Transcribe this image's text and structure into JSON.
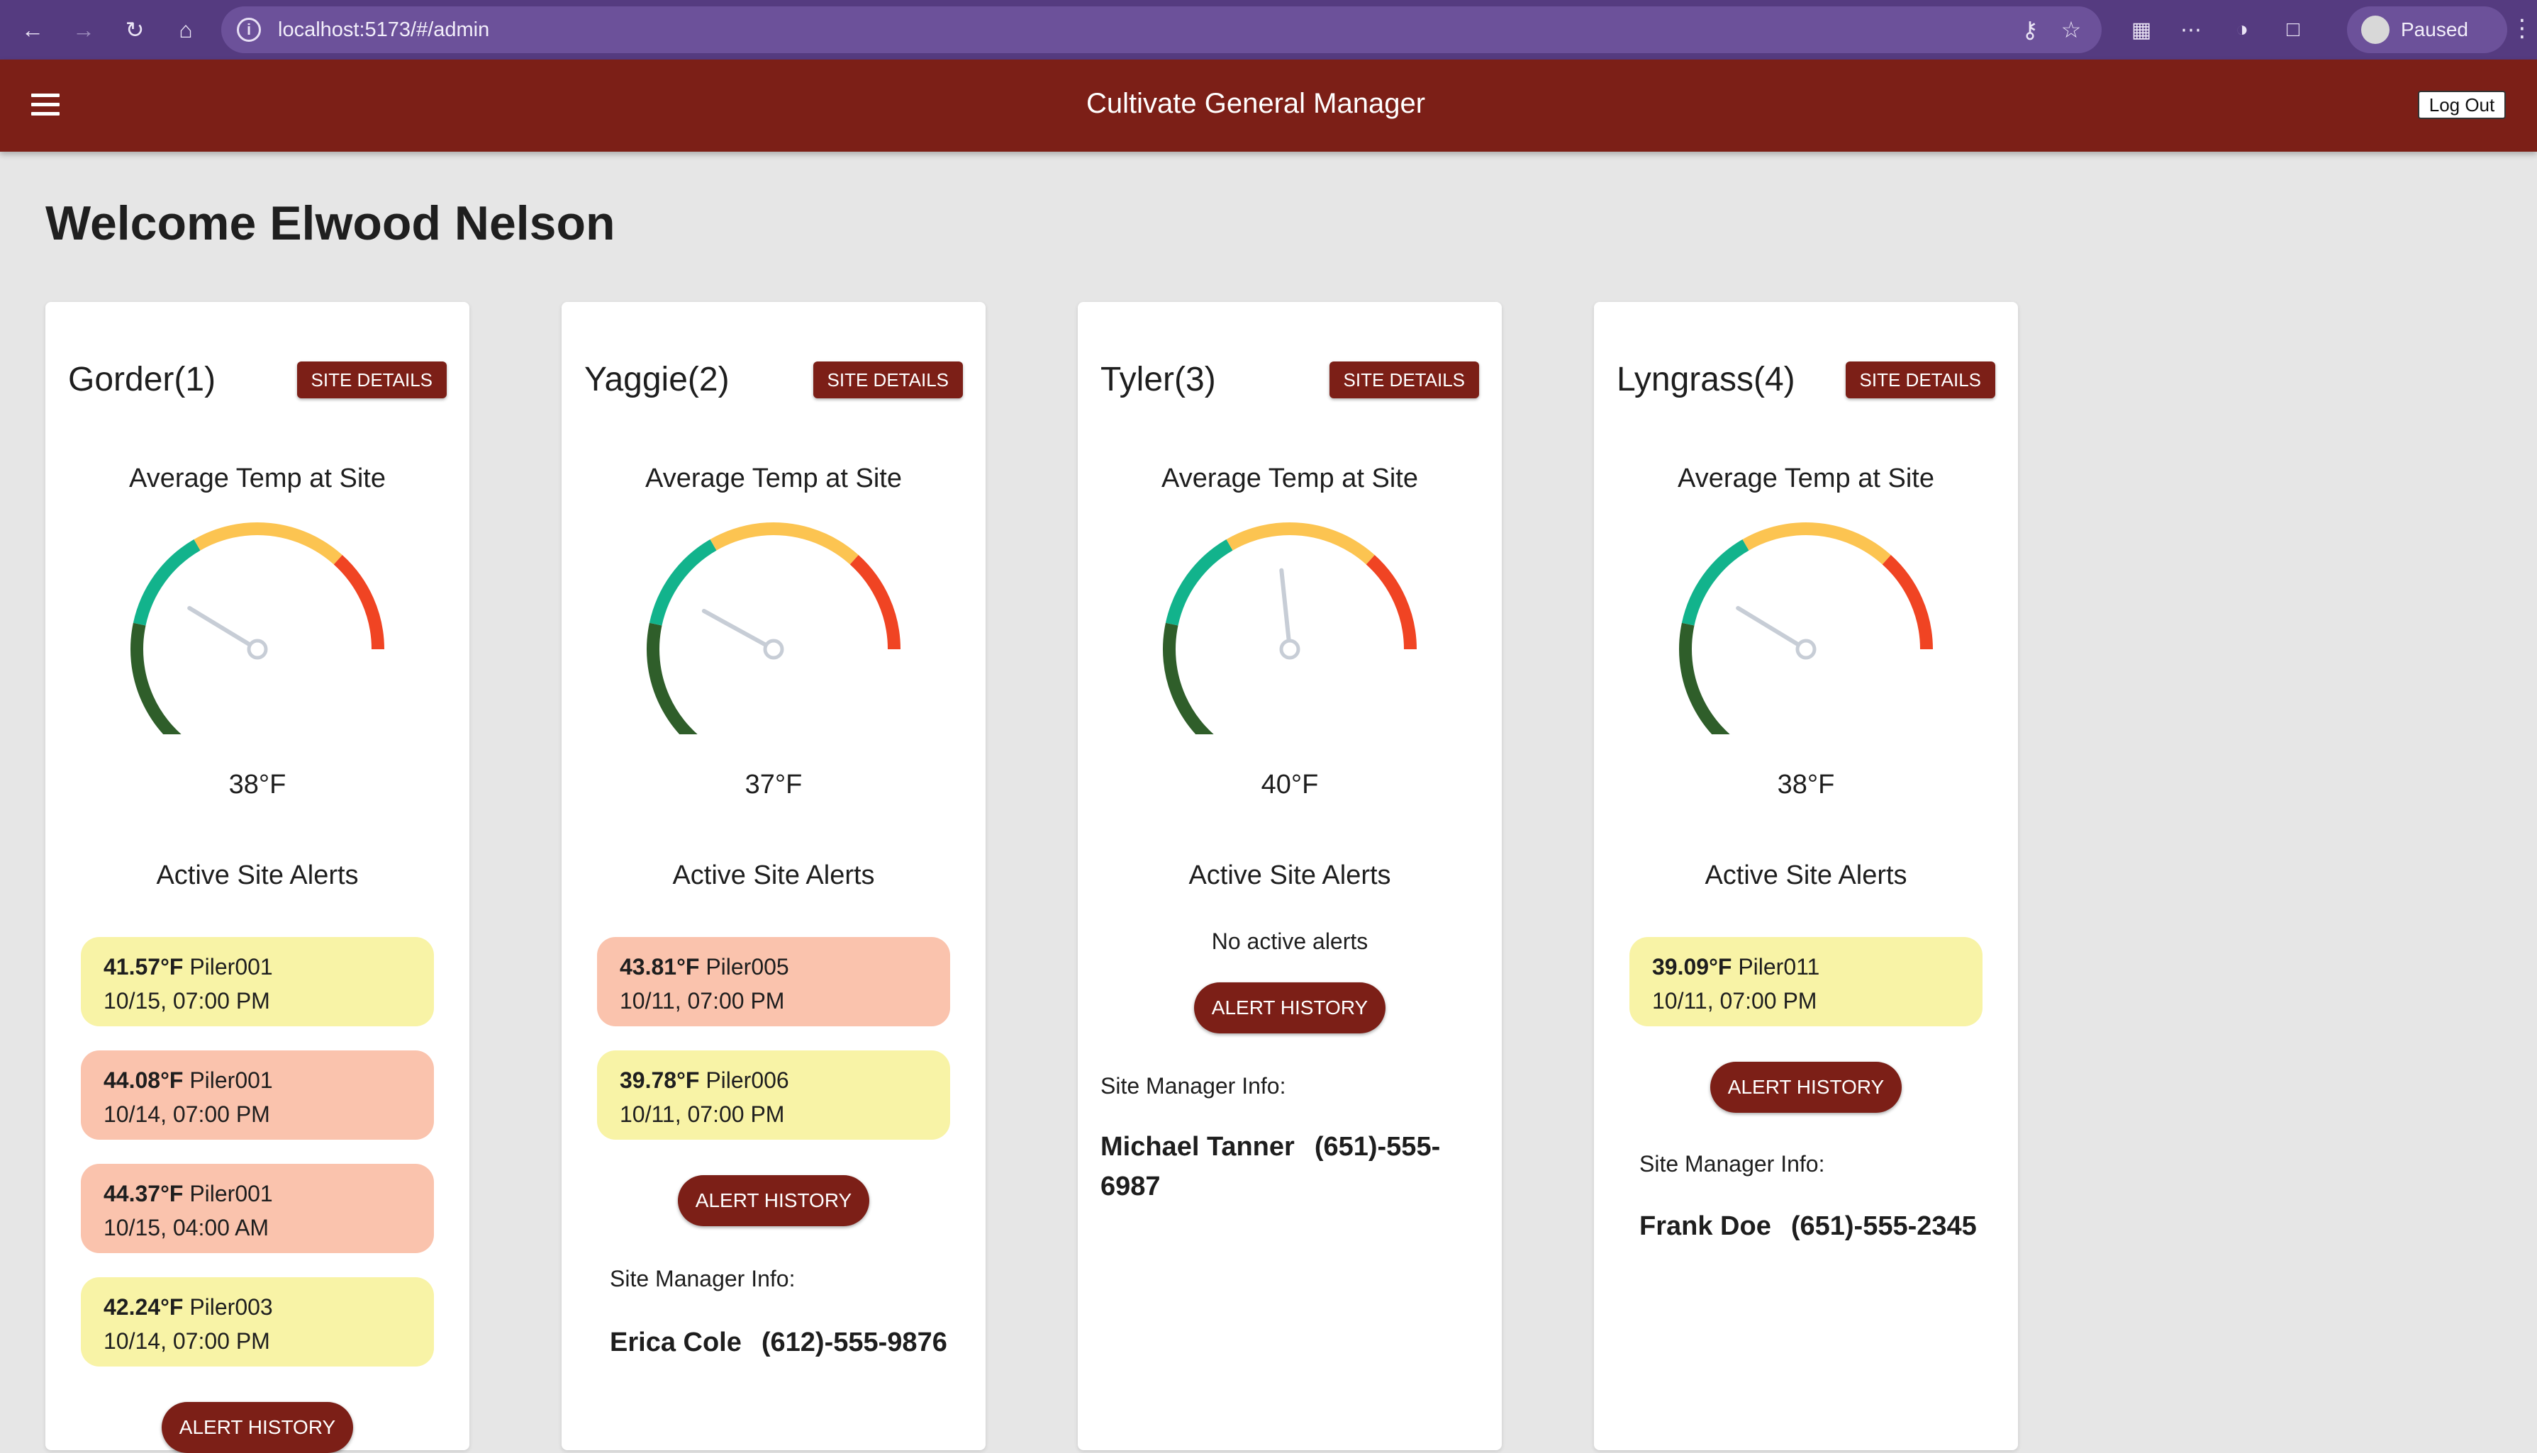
{
  "browser": {
    "url": "localhost:5173/#/admin",
    "profile_status": "Paused"
  },
  "app": {
    "title": "Cultivate General Manager",
    "logout_label": "Log Out"
  },
  "page": {
    "welcome": "Welcome Elwood Nelson"
  },
  "labels": {
    "site_details": "SITE DETAILS",
    "avg_temp": "Average Temp at Site",
    "active_alerts": "Active Site Alerts",
    "alert_history": "ALERT HISTORY",
    "manager_info": "Site Manager Info:",
    "no_alerts": "No active alerts"
  },
  "gauge_colors": {
    "cold": "#2f5e2a",
    "ok": "#12b38c",
    "warm": "#fcc451",
    "hot": "#f04423",
    "needle": "#c7cdd6"
  },
  "sites": [
    {
      "name": "Gorder(1)",
      "temp": "38°F",
      "needle_fraction": 0.38,
      "alerts": [
        {
          "temp": "41.57°F",
          "piler": "Piler001",
          "time": "10/15, 07:00 PM",
          "level": "warn"
        },
        {
          "temp": "44.08°F",
          "piler": "Piler001",
          "time": "10/14, 07:00 PM",
          "level": "crit"
        },
        {
          "temp": "44.37°F",
          "piler": "Piler001",
          "time": "10/15, 04:00 AM",
          "level": "crit"
        },
        {
          "temp": "42.24°F",
          "piler": "Piler003",
          "time": "10/14, 07:00 PM",
          "level": "warn"
        }
      ],
      "manager": {
        "name": "",
        "phone": ""
      }
    },
    {
      "name": "Yaggie(2)",
      "temp": "37°F",
      "needle_fraction": 0.37,
      "alerts": [
        {
          "temp": "43.81°F",
          "piler": "Piler005",
          "time": "10/11, 07:00 PM",
          "level": "crit"
        },
        {
          "temp": "39.78°F",
          "piler": "Piler006",
          "time": "10/11, 07:00 PM",
          "level": "warn"
        }
      ],
      "manager": {
        "name": "Erica Cole",
        "phone": "(612)-555-9876"
      }
    },
    {
      "name": "Tyler(3)",
      "temp": "40°F",
      "needle_fraction": 0.6,
      "alerts": [],
      "manager": {
        "name": "Michael Tanner",
        "phone": "(651)-555-",
        "phone_cont": "6987"
      }
    },
    {
      "name": "Lyngrass(4)",
      "temp": "38°F",
      "needle_fraction": 0.38,
      "alerts": [
        {
          "temp": "39.09°F",
          "piler": "Piler011",
          "time": "10/11, 07:00 PM",
          "level": "warn"
        }
      ],
      "manager": {
        "name": "Frank Doe",
        "phone": "(651)-555-2345"
      }
    }
  ]
}
